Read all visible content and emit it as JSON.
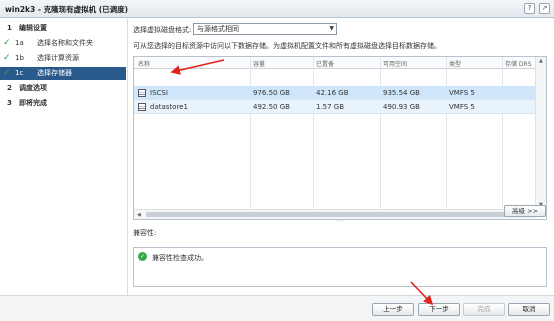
{
  "window": {
    "title": "win2k3 - 克隆现有虚拟机 (已调度)"
  },
  "sidebar": {
    "steps": [
      {
        "num": "1",
        "label": "编辑设置"
      },
      {
        "num": "1a",
        "label": "选择名称和文件夹"
      },
      {
        "num": "1b",
        "label": "选择计算资源"
      },
      {
        "num": "1c",
        "label": "选择存储器"
      },
      {
        "num": "2",
        "label": "调度选项"
      },
      {
        "num": "3",
        "label": "即将完成"
      }
    ]
  },
  "content": {
    "format_label": "选择虚拟磁盘格式:",
    "format_value": "与源格式相同",
    "description": "可从您选择的目标资源中访问以下数据存储。为虚拟机配置文件和所有虚拟磁盘选择目标数据存储。",
    "table": {
      "columns": [
        "名称",
        "容量",
        "已置备",
        "可用空间",
        "类型",
        "存储 DRS"
      ],
      "rows": [
        {
          "name": "ISCSI",
          "capacity": "976.50 GB",
          "provisioned": "42.16 GB",
          "free": "935.54 GB",
          "type": "VMFS 5",
          "drs": ""
        },
        {
          "name": "datastore1",
          "capacity": "492.50 GB",
          "provisioned": "1.57 GB",
          "free": "490.93 GB",
          "type": "VMFS 5",
          "drs": ""
        }
      ]
    },
    "advanced_button": "高级 >>",
    "compat_label": "兼容性:",
    "compat_message": "兼容性检查成功。"
  },
  "footer": {
    "back": "上一步",
    "next": "下一步",
    "finish": "完成",
    "cancel": "取消"
  },
  "colors": {
    "active_step": "#295a8c",
    "selected_row": "#cfe6fb",
    "annotation_red": "#e0221a",
    "success_green": "#3aa64a"
  }
}
